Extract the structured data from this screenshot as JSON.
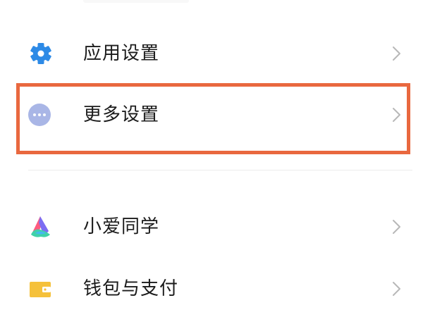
{
  "settings": {
    "items": [
      {
        "label": "应用设置",
        "icon": "gear-icon"
      },
      {
        "label": "更多设置",
        "icon": "more-dots-icon"
      },
      {
        "label": "小爱同学",
        "icon": "xiaoai-logo-icon"
      },
      {
        "label": "钱包与支付",
        "icon": "wallet-icon"
      }
    ]
  },
  "colors": {
    "highlight": "#e9683f",
    "gear": "#2d8ae6",
    "more_dots": "#a9b6e6",
    "wallet": "#f5c13b",
    "chevron": "#b8b8b8"
  }
}
